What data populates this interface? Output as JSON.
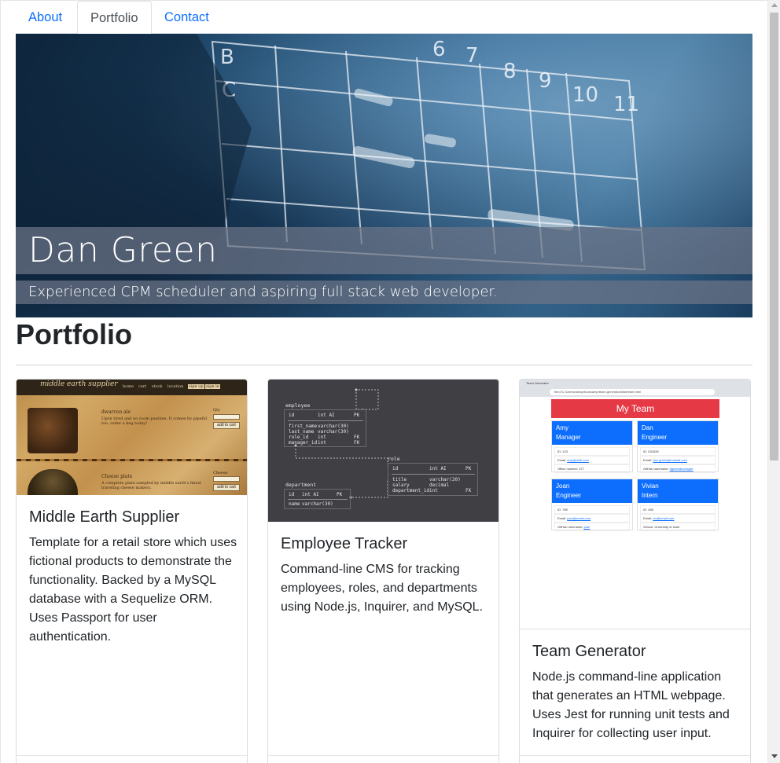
{
  "nav": {
    "tabs": [
      {
        "label": "About",
        "active": false
      },
      {
        "label": "Portfolio",
        "active": true
      },
      {
        "label": "Contact",
        "active": false
      }
    ]
  },
  "hero": {
    "title": "Dan Green",
    "subtitle": "Experienced CPM scheduler and aspiring full stack web developer.",
    "background_icon": "calendar-grid-photo",
    "accent": "#2f6592"
  },
  "section": {
    "title": "Portfolio"
  },
  "projects": [
    {
      "title": "Middle Earth Supplier",
      "description": "Template for a retail store which uses fictional products to demonstrate the functionality. Backed by a MySQL database with a Sequelize ORM. Uses Passport for user authentication.",
      "thumbnail": {
        "site_title": "middle earth supplier",
        "nav": [
          "home",
          "cart",
          "stock",
          "location",
          "sign up",
          "sign in"
        ],
        "item1_name": "dwarven ale",
        "item1_text": "Upon tired and no room pastime. It comes by pipeful too, order a keg today!",
        "item1_qty_label": "Qty",
        "item1_button": "add to cart",
        "item2_name": "Cheese plate",
        "item2_text": "A complete plate sampled by middle earth's finest traveling cheese makers.",
        "item2_qty_label": "Cheese",
        "item2_button": "add to cart"
      }
    },
    {
      "title": "Employee Tracker",
      "description": "Command-line CMS for tracking employees, roles, and departments using Node.js, Inquirer, and MySQL.",
      "thumbnail": {
        "employee": {
          "name": "employee",
          "rows": [
            {
              "col": "id",
              "type": "int AI",
              "key": "PK"
            },
            {
              "col": "first_name",
              "type": "varchar(30)",
              "key": ""
            },
            {
              "col": "last_name",
              "type": "varchar(30)",
              "key": ""
            },
            {
              "col": "role_id",
              "type": "int",
              "key": "FK"
            },
            {
              "col": "manager_id",
              "type": "int",
              "key": "FK"
            }
          ]
        },
        "role": {
          "name": "role",
          "rows": [
            {
              "col": "id",
              "type": "int AI",
              "key": "PK"
            },
            {
              "col": "title",
              "type": "varchar(30)",
              "key": ""
            },
            {
              "col": "salary",
              "type": "decimal",
              "key": ""
            },
            {
              "col": "department_id",
              "type": "int",
              "key": "FK"
            }
          ]
        },
        "department": {
          "name": "department",
          "rows": [
            {
              "col": "id",
              "type": "int AI",
              "key": "PK"
            },
            {
              "col": "name",
              "type": "varchar(30)",
              "key": ""
            }
          ]
        }
      }
    },
    {
      "title": "Team Generator",
      "description": "Node.js command-line application that generates an HTML webpage. Uses Jest for running unit tests and Inquirer for collecting user input.",
      "thumbnail": {
        "tab_title": "Team Generator",
        "url": "file:///C:/Users/dansy/bootcamp/team-generator/dist/team.html",
        "banner": "My Team",
        "members": [
          {
            "name": "Amy",
            "role": "Manager",
            "id": "ID: 123",
            "email": "amy@mail.com",
            "extra_label": "Office number:",
            "extra_value": "277"
          },
          {
            "name": "Dan",
            "role": "Engineer",
            "id": "ID: 031839",
            "email": "dan.green@hotmail.com",
            "extra_label": "GitHub username:",
            "extra_value": "dgreendeveloper"
          },
          {
            "name": "Joan",
            "role": "Engineer",
            "id": "ID: 789",
            "email": "joan@email.com",
            "extra_label": "GitHub username:",
            "extra_value": "joan"
          },
          {
            "name": "Vivian",
            "role": "Intern",
            "id": "ID: 456",
            "email": "viv@email.com",
            "extra_label": "School:",
            "extra_value": "University of Utah"
          }
        ]
      }
    }
  ],
  "colors": {
    "link": "#0d6efd",
    "text": "#212529",
    "banner_red": "#e63946",
    "card_blue": "#0d6efd"
  }
}
